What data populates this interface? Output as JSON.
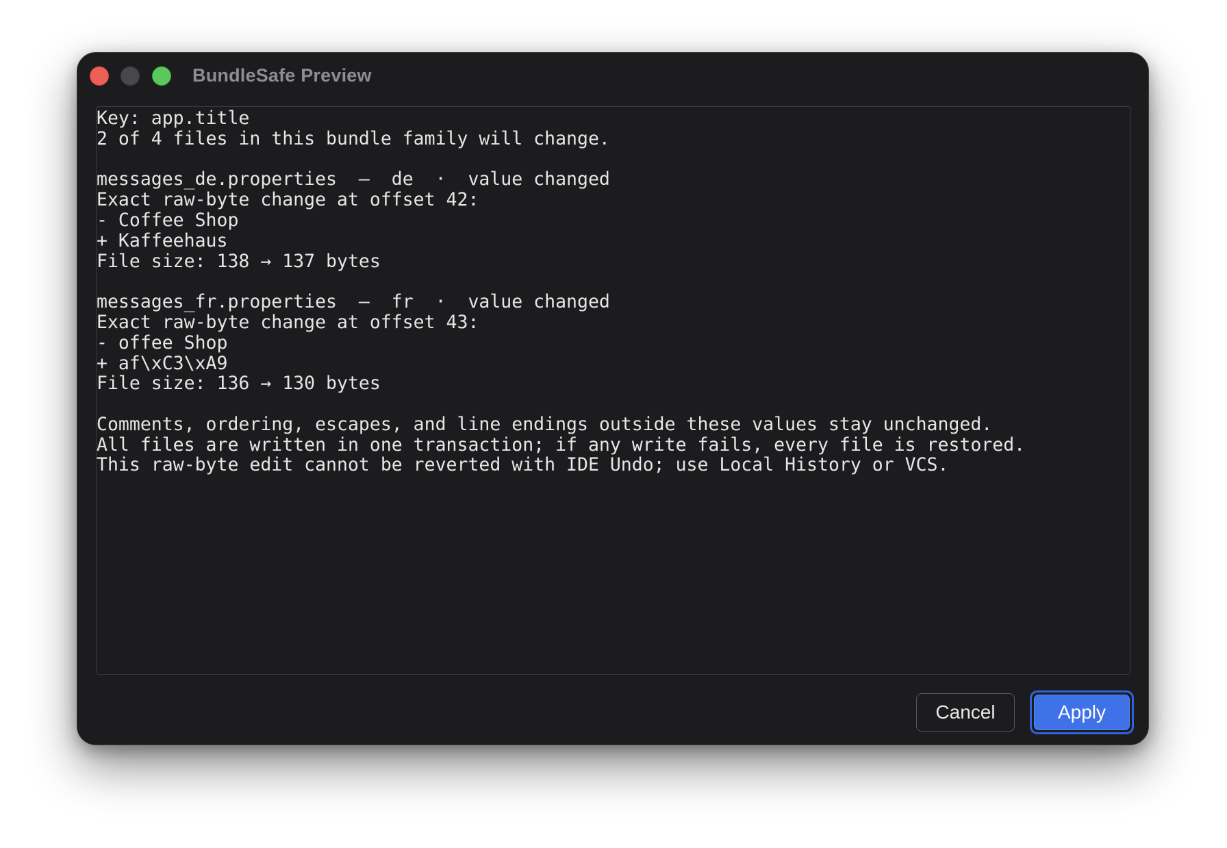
{
  "window": {
    "title": "BundleSafe Preview"
  },
  "preview": {
    "lines": [
      "Key: app.title",
      "2 of 4 files in this bundle family will change.",
      "",
      "messages_de.properties  —  de  ·  value changed",
      "Exact raw-byte change at offset 42:",
      "- Coffee Shop",
      "+ Kaffeehaus",
      "File size: 138 → 137 bytes",
      "",
      "messages_fr.properties  —  fr  ·  value changed",
      "Exact raw-byte change at offset 43:",
      "- offee Shop",
      "+ af\\xC3\\xA9",
      "File size: 136 → 130 bytes",
      "",
      "Comments, ordering, escapes, and line endings outside these values stay unchanged.",
      "All files are written in one transaction; if any write fails, every file is restored.",
      "This raw-byte edit cannot be reverted with IDE Undo; use Local History or VCS."
    ]
  },
  "buttons": {
    "cancel_label": "Cancel",
    "apply_label": "Apply"
  },
  "colors": {
    "window_background": "#1c1c1e",
    "text": "#e6e6e6",
    "accent": "#3e72e6",
    "close": "#ee5f58",
    "minimize": "#48484b",
    "maximize": "#5ac85a"
  }
}
